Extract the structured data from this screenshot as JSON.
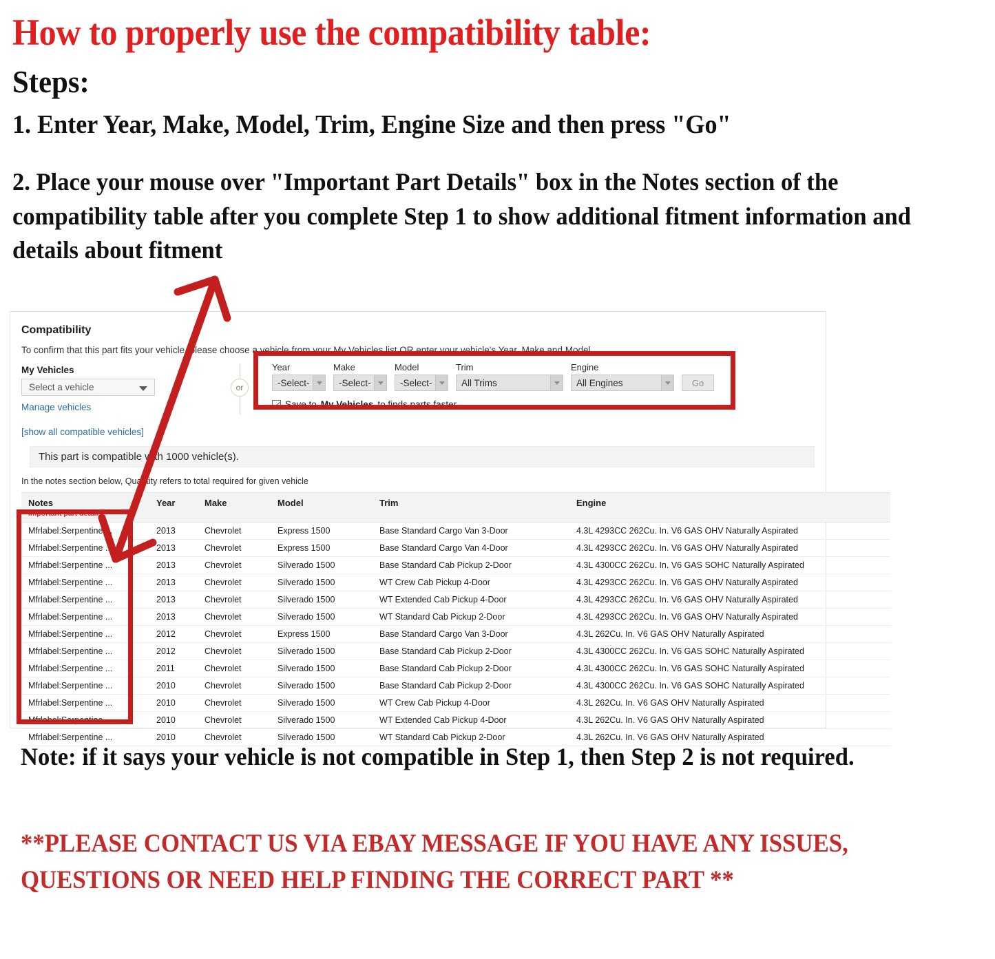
{
  "headline": "How to properly use the compatibility table:",
  "steps_label": "Steps:",
  "step1": "1. Enter Year, Make, Model, Trim, Engine Size and then press \"Go\"",
  "step2": "2. Place your mouse over \"Important Part Details\" box in the Notes section of the compatibility table after you complete Step 1 to show additional fitment information and details about fitment",
  "note": "Note: if it says your vehicle is not compatible in Step 1, then Step 2 is not required.",
  "contact": "**PLEASE CONTACT US VIA EBAY MESSAGE IF YOU HAVE ANY ISSUES, QUESTIONS OR NEED HELP FINDING THE CORRECT PART **",
  "colors": {
    "headline_red": "#e02020",
    "annotation_red": "#c41f1f",
    "contact_red": "#c32a2a",
    "link_blue": "#2b6ca3",
    "important_red": "#cc2026"
  },
  "compatibility": {
    "title": "Compatibility",
    "subtitle": "To confirm that this part fits your vehicle, please choose a vehicle from your My Vehicles list OR enter your vehicle's Year, Make and Model.",
    "my_vehicles_label": "My Vehicles",
    "my_vehicles_value": "Select a vehicle",
    "manage_vehicles_link": "Manage vehicles",
    "or_label": "or",
    "show_all_link": "[show all compatible vehicles]",
    "compatible_banner": "This part is compatible with 1000 vehicle(s).",
    "notes_hint": "In the notes section below, Quantity refers to total required for given vehicle",
    "finder": {
      "fields": [
        {
          "label": "Year",
          "value": "-Select-"
        },
        {
          "label": "Make",
          "value": "-Select-"
        },
        {
          "label": "Model",
          "value": "-Select-"
        },
        {
          "label": "Trim",
          "value": "All Trims"
        },
        {
          "label": "Engine",
          "value": "All Engines"
        }
      ],
      "go_label": "Go",
      "save_prefix": "Save to",
      "save_bold": "My Vehicles",
      "save_suffix": "to finds parts faster",
      "save_checked": true
    },
    "table": {
      "headers": {
        "notes": "Notes",
        "notes_sub": "Important part details",
        "year": "Year",
        "make": "Make",
        "model": "Model",
        "trim": "Trim",
        "engine": "Engine"
      },
      "rows": [
        {
          "notes": "Mfrlabel:Serpentine ...",
          "year": "2013",
          "make": "Chevrolet",
          "model": "Express 1500",
          "trim": "Base Standard Cargo Van 3-Door",
          "engine": "4.3L 4293CC 262Cu. In. V6 GAS OHV Naturally Aspirated"
        },
        {
          "notes": "Mfrlabel:Serpentine ...",
          "year": "2013",
          "make": "Chevrolet",
          "model": "Express 1500",
          "trim": "Base Standard Cargo Van 4-Door",
          "engine": "4.3L 4293CC 262Cu. In. V6 GAS OHV Naturally Aspirated"
        },
        {
          "notes": "Mfrlabel:Serpentine ...",
          "year": "2013",
          "make": "Chevrolet",
          "model": "Silverado 1500",
          "trim": "Base Standard Cab Pickup 2-Door",
          "engine": "4.3L 4300CC 262Cu. In. V6 GAS SOHC Naturally Aspirated"
        },
        {
          "notes": "Mfrlabel:Serpentine ...",
          "year": "2013",
          "make": "Chevrolet",
          "model": "Silverado 1500",
          "trim": "WT Crew Cab Pickup 4-Door",
          "engine": "4.3L 4293CC 262Cu. In. V6 GAS OHV Naturally Aspirated"
        },
        {
          "notes": "Mfrlabel:Serpentine ...",
          "year": "2013",
          "make": "Chevrolet",
          "model": "Silverado 1500",
          "trim": "WT Extended Cab Pickup 4-Door",
          "engine": "4.3L 4293CC 262Cu. In. V6 GAS OHV Naturally Aspirated"
        },
        {
          "notes": "Mfrlabel:Serpentine ...",
          "year": "2013",
          "make": "Chevrolet",
          "model": "Silverado 1500",
          "trim": "WT Standard Cab Pickup 2-Door",
          "engine": "4.3L 4293CC 262Cu. In. V6 GAS OHV Naturally Aspirated"
        },
        {
          "notes": "Mfrlabel:Serpentine ...",
          "year": "2012",
          "make": "Chevrolet",
          "model": "Express 1500",
          "trim": "Base Standard Cargo Van 3-Door",
          "engine": "4.3L 262Cu. In. V6 GAS OHV Naturally Aspirated"
        },
        {
          "notes": "Mfrlabel:Serpentine ...",
          "year": "2012",
          "make": "Chevrolet",
          "model": "Silverado 1500",
          "trim": "Base Standard Cab Pickup 2-Door",
          "engine": "4.3L 4300CC 262Cu. In. V6 GAS SOHC Naturally Aspirated"
        },
        {
          "notes": "Mfrlabel:Serpentine ...",
          "year": "2011",
          "make": "Chevrolet",
          "model": "Silverado 1500",
          "trim": "Base Standard Cab Pickup 2-Door",
          "engine": "4.3L 4300CC 262Cu. In. V6 GAS SOHC Naturally Aspirated"
        },
        {
          "notes": "Mfrlabel:Serpentine ...",
          "year": "2010",
          "make": "Chevrolet",
          "model": "Silverado 1500",
          "trim": "Base Standard Cab Pickup 2-Door",
          "engine": "4.3L 4300CC 262Cu. In. V6 GAS SOHC Naturally Aspirated"
        },
        {
          "notes": "Mfrlabel:Serpentine ...",
          "year": "2010",
          "make": "Chevrolet",
          "model": "Silverado 1500",
          "trim": "WT Crew Cab Pickup 4-Door",
          "engine": "4.3L 262Cu. In. V6 GAS OHV Naturally Aspirated"
        },
        {
          "notes": "Mfrlabel:Serpentine ...",
          "year": "2010",
          "make": "Chevrolet",
          "model": "Silverado 1500",
          "trim": "WT Extended Cab Pickup 4-Door",
          "engine": "4.3L 262Cu. In. V6 GAS OHV Naturally Aspirated"
        },
        {
          "notes": "Mfrlabel:Serpentine ...",
          "year": "2010",
          "make": "Chevrolet",
          "model": "Silverado 1500",
          "trim": "WT Standard Cab Pickup 2-Door",
          "engine": "4.3L 262Cu. In. V6 GAS OHV Naturally Aspirated"
        }
      ]
    }
  }
}
